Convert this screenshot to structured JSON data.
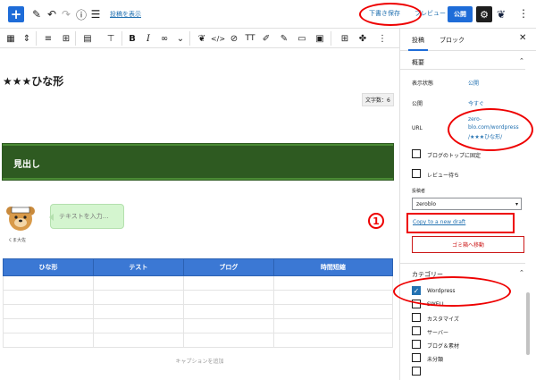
{
  "topbar": {
    "view_post_link": "投稿を表示",
    "save_draft": "下書き保存",
    "preview": "プレビュー",
    "publish": "公開"
  },
  "editor": {
    "post_title": "★★★ひな形",
    "word_count": "文字数：6",
    "heading_text": "見出し",
    "avatar_name": "くま大佐",
    "bubble_placeholder": "テキストを入力...",
    "table_headers": [
      "ひな形",
      "テスト",
      "ブログ",
      "時間短縮"
    ],
    "table_caption": "キャプションを追加"
  },
  "sidebar": {
    "tabs": [
      "投稿",
      "ブロック"
    ],
    "summary_title": "概要",
    "visibility_label": "表示状態",
    "visibility_value": "公開",
    "publish_label": "公開",
    "publish_value": "今すぐ",
    "url_label": "URL",
    "url_value_1": "zero-",
    "url_value_2": "blo.com/wordpress",
    "url_value_3": "/★★★ひな形/",
    "sticky_label": "ブログのトップに固定",
    "pending_label": "レビュー待ち",
    "author_label": "投稿者",
    "author_value": "zeroblo",
    "copy_draft": "Copy to a new draft",
    "trash_button": "ゴミ箱へ移動",
    "categories_title": "カテゴリー",
    "categories": [
      {
        "label": "Wordpress",
        "checked": true
      },
      {
        "label": "SWELL",
        "checked": false
      },
      {
        "label": "カスタマイズ",
        "checked": false
      },
      {
        "label": "サーバー",
        "checked": false
      },
      {
        "label": "ブログ＆素材",
        "checked": false
      },
      {
        "label": "未分類",
        "checked": false
      }
    ]
  },
  "annotation": {
    "number": "1"
  },
  "colors": {
    "accent": "#1e6cd8",
    "heading_bg": "#2e5a21",
    "table_header": "#3b78d4",
    "annotation_red": "#ee0000"
  }
}
